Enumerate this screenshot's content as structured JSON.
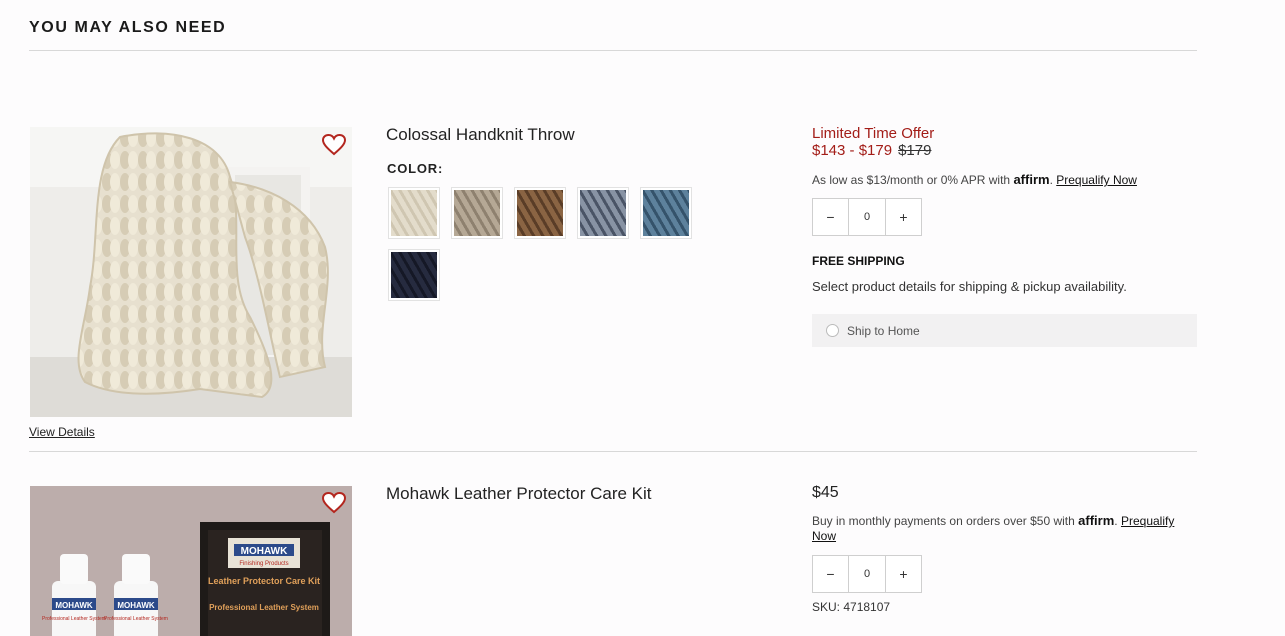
{
  "section": {
    "title": "YOU MAY ALSO NEED"
  },
  "products": [
    {
      "name": "Colossal Handknit Throw",
      "view_details": "View Details",
      "color_label": "COLOR:",
      "swatches": [
        {
          "name": "ivory",
          "color": "#e3dccb"
        },
        {
          "name": "oatmeal",
          "color": "#b5a895"
        },
        {
          "name": "caramel",
          "color": "#7e5a3c"
        },
        {
          "name": "gray-blue",
          "color": "#6d7a8c"
        },
        {
          "name": "denim",
          "color": "#4d6f8a"
        },
        {
          "name": "navy",
          "color": "#1e2233"
        }
      ],
      "offer": "Limited Time Offer",
      "price_range": "$143 - $179",
      "original_price": "$179",
      "affirm_prefix": "As low as $13/month or 0% APR with",
      "affirm_brand": "affirm",
      "affirm_link": "Prequalify Now",
      "quantity": "0",
      "minus": "−",
      "plus": "+",
      "free_shipping": "FREE SHIPPING",
      "shipping_note": "Select product details for shipping & pickup availability.",
      "ship_option": "Ship to Home"
    },
    {
      "name": "Mohawk Leather Protector Care Kit",
      "price": "$45",
      "affirm_prefix": "Buy in monthly payments on orders over $50 with",
      "affirm_brand": "affirm",
      "affirm_link_1": "Prequalify",
      "affirm_link_2": "Now",
      "quantity": "0",
      "minus": "−",
      "plus": "+",
      "sku": "SKU: 4718107",
      "box_brand": "MOHAWK",
      "box_sub": "Finishing Products",
      "box_title": "Leather Protector Care Kit",
      "box_tagline": "Professional Leather System",
      "bottle_brand": "MOHAWK",
      "bottle_sub": "Professional Leather System"
    }
  ],
  "colors": {
    "accent_red": "#a31d18",
    "rule": "#d8d8d8"
  }
}
